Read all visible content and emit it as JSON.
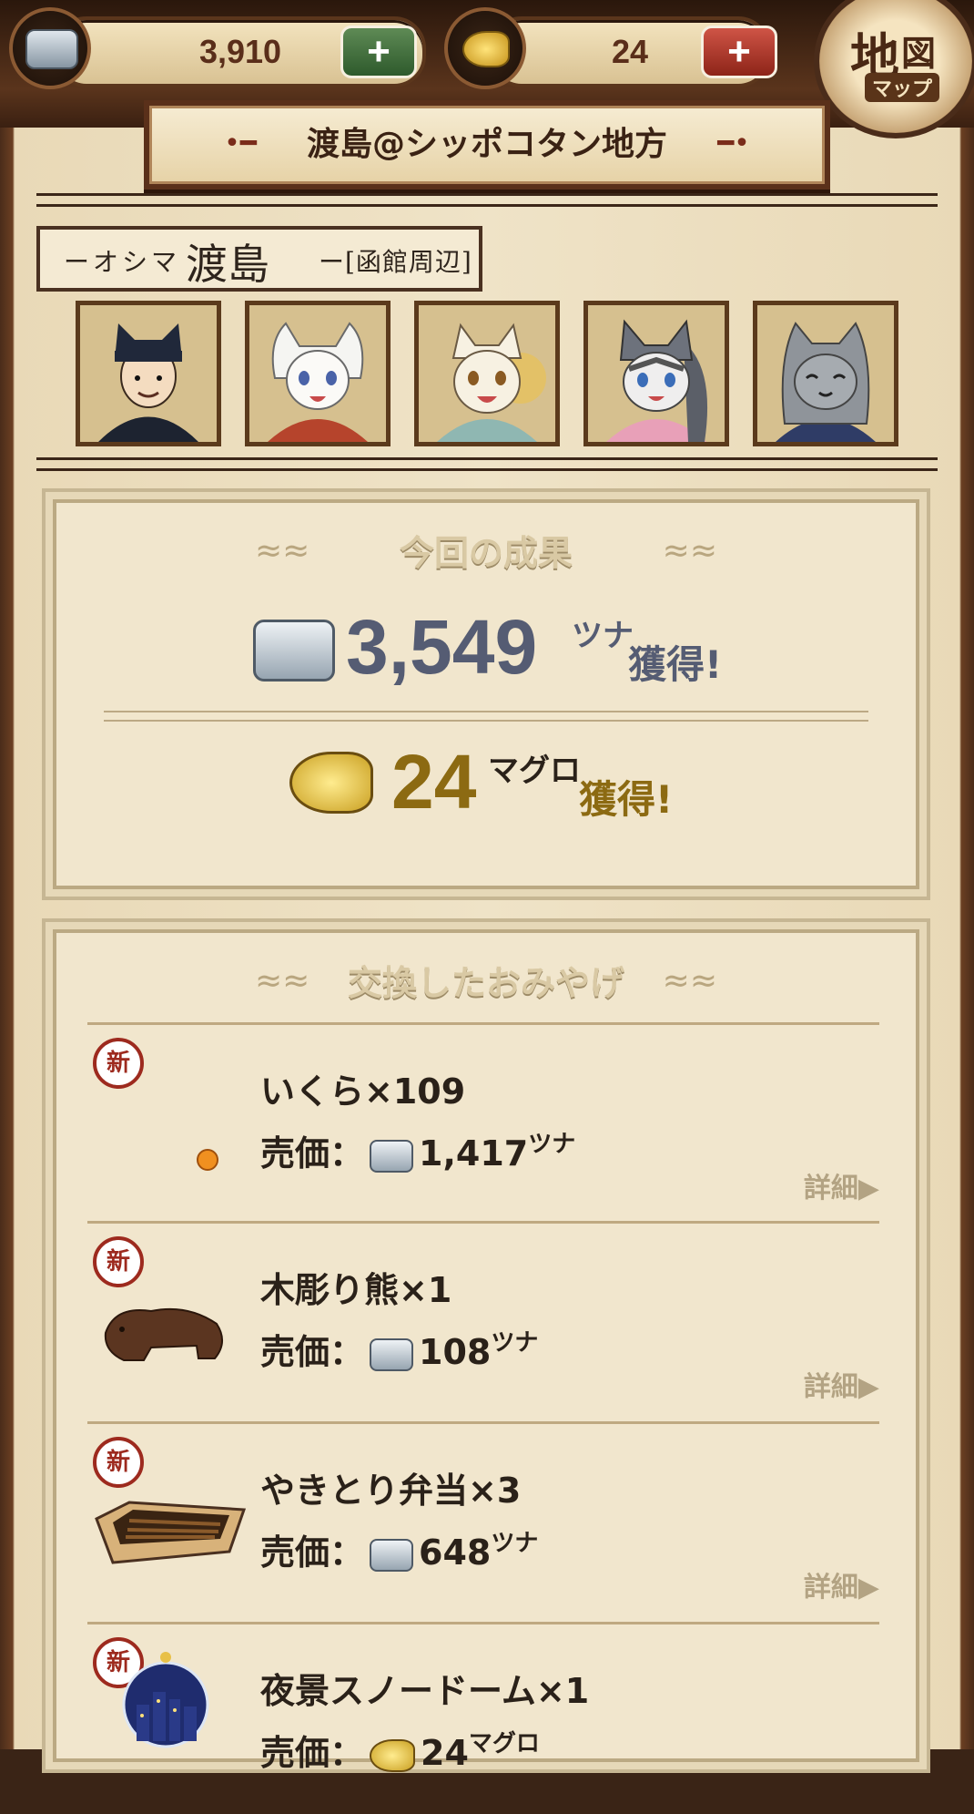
{
  "header": {
    "tuna_value": "3,910",
    "maguro_value": "24",
    "map_button": {
      "kanji1": "地",
      "kanji2": "図",
      "kana": "マップ"
    }
  },
  "banner": {
    "title": "渡島@シッポコタン地方"
  },
  "location": {
    "reading": "ーオシマ",
    "name": "渡島",
    "area": "ー[函館周辺]"
  },
  "characters": [
    {
      "name": "student-boy"
    },
    {
      "name": "white-cat-girl"
    },
    {
      "name": "cream-cat-girl"
    },
    {
      "name": "gray-cat-girl"
    },
    {
      "name": "gray-cat-smile"
    }
  ],
  "results": {
    "heading": "今回の成果",
    "tuna": {
      "value": "3,549",
      "unit": "ツナ",
      "suffix": "獲得!"
    },
    "maguro": {
      "value": "24",
      "unit": "マグロ",
      "suffix": "獲得!"
    }
  },
  "souvenirs": {
    "heading": "交換したおみやげ",
    "new_label": "新",
    "price_label": "売価：",
    "detail_label": "詳細▶",
    "items": [
      {
        "name": "いくら×109",
        "price": "1,417",
        "currency": "ツナ"
      },
      {
        "name": "木彫り熊×1",
        "price": "108",
        "currency": "ツナ"
      },
      {
        "name": "やきとり弁当×3",
        "price": "648",
        "currency": "ツナ"
      },
      {
        "name": "夜景スノードーム×1",
        "price": "24",
        "currency": "マグロ"
      }
    ]
  },
  "colors": {
    "accent_wood": "#5a301a",
    "tuna_blue": "#555c73",
    "maguro_gold": "#8c6a12",
    "badge_red": "#9d2a1e"
  }
}
